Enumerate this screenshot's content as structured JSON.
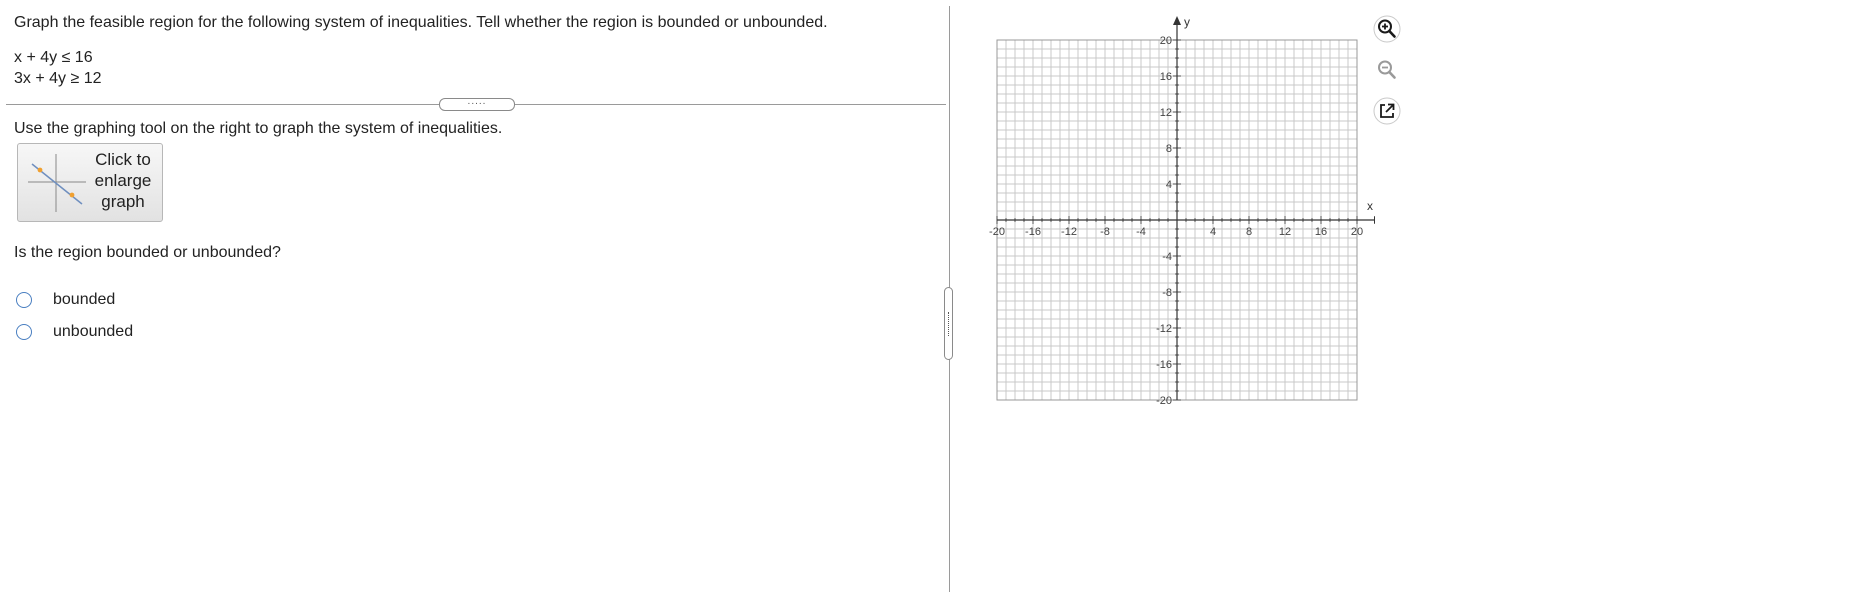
{
  "question": {
    "prompt": "Graph the feasible region for the following system of inequalities. Tell whether the region is bounded or unbounded.",
    "inequalities": [
      "x + 4y ≤ 16",
      "3x + 4y ≥ 12"
    ],
    "instruction": "Use the graphing tool on the right to graph the system of inequalities.",
    "enlarge_button": "Click to enlarge graph",
    "part2": "Is the region bounded or unbounded?",
    "options": [
      "bounded",
      "unbounded"
    ]
  },
  "splitter": {
    "horizontal_grip": ".....",
    "vertical_grip": "....."
  },
  "graph": {
    "x_axis_label": "x",
    "y_axis_label": "y",
    "x_range": [
      -20,
      20
    ],
    "y_range": [
      -20,
      20
    ],
    "grid_step": 1,
    "tick_labels_x": [
      "-20",
      "-16",
      "-12",
      "-8",
      "-4",
      "4",
      "8",
      "12",
      "16",
      "20"
    ],
    "tick_labels_y": [
      "20",
      "16",
      "12",
      "8",
      "4",
      "-4",
      "-8",
      "-12",
      "-16",
      "-20"
    ],
    "grid_color": "#c8c8c8",
    "axis_color": "#333333"
  },
  "tools": {
    "zoom_in": "zoom-in-icon",
    "zoom_out": "zoom-out-icon",
    "popout": "new-window-icon"
  }
}
